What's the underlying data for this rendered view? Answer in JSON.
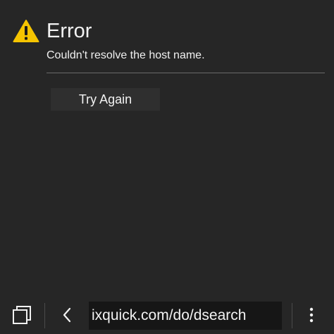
{
  "error": {
    "icon": "warning-icon",
    "title": "Error",
    "message": "Couldn't resolve the host name.",
    "retry_label": "Try Again"
  },
  "toolbar": {
    "tabs_icon": "tabs-icon",
    "back_icon": "back-chevron-icon",
    "address": "ixquick.com/do/dsearch",
    "menu_icon": "overflow-menu-icon"
  },
  "colors": {
    "background": "#262626",
    "warning_yellow": "#f5c400",
    "divider": "#6a6a6a",
    "button_bg": "#2f2f2f",
    "address_bg": "#161616"
  }
}
